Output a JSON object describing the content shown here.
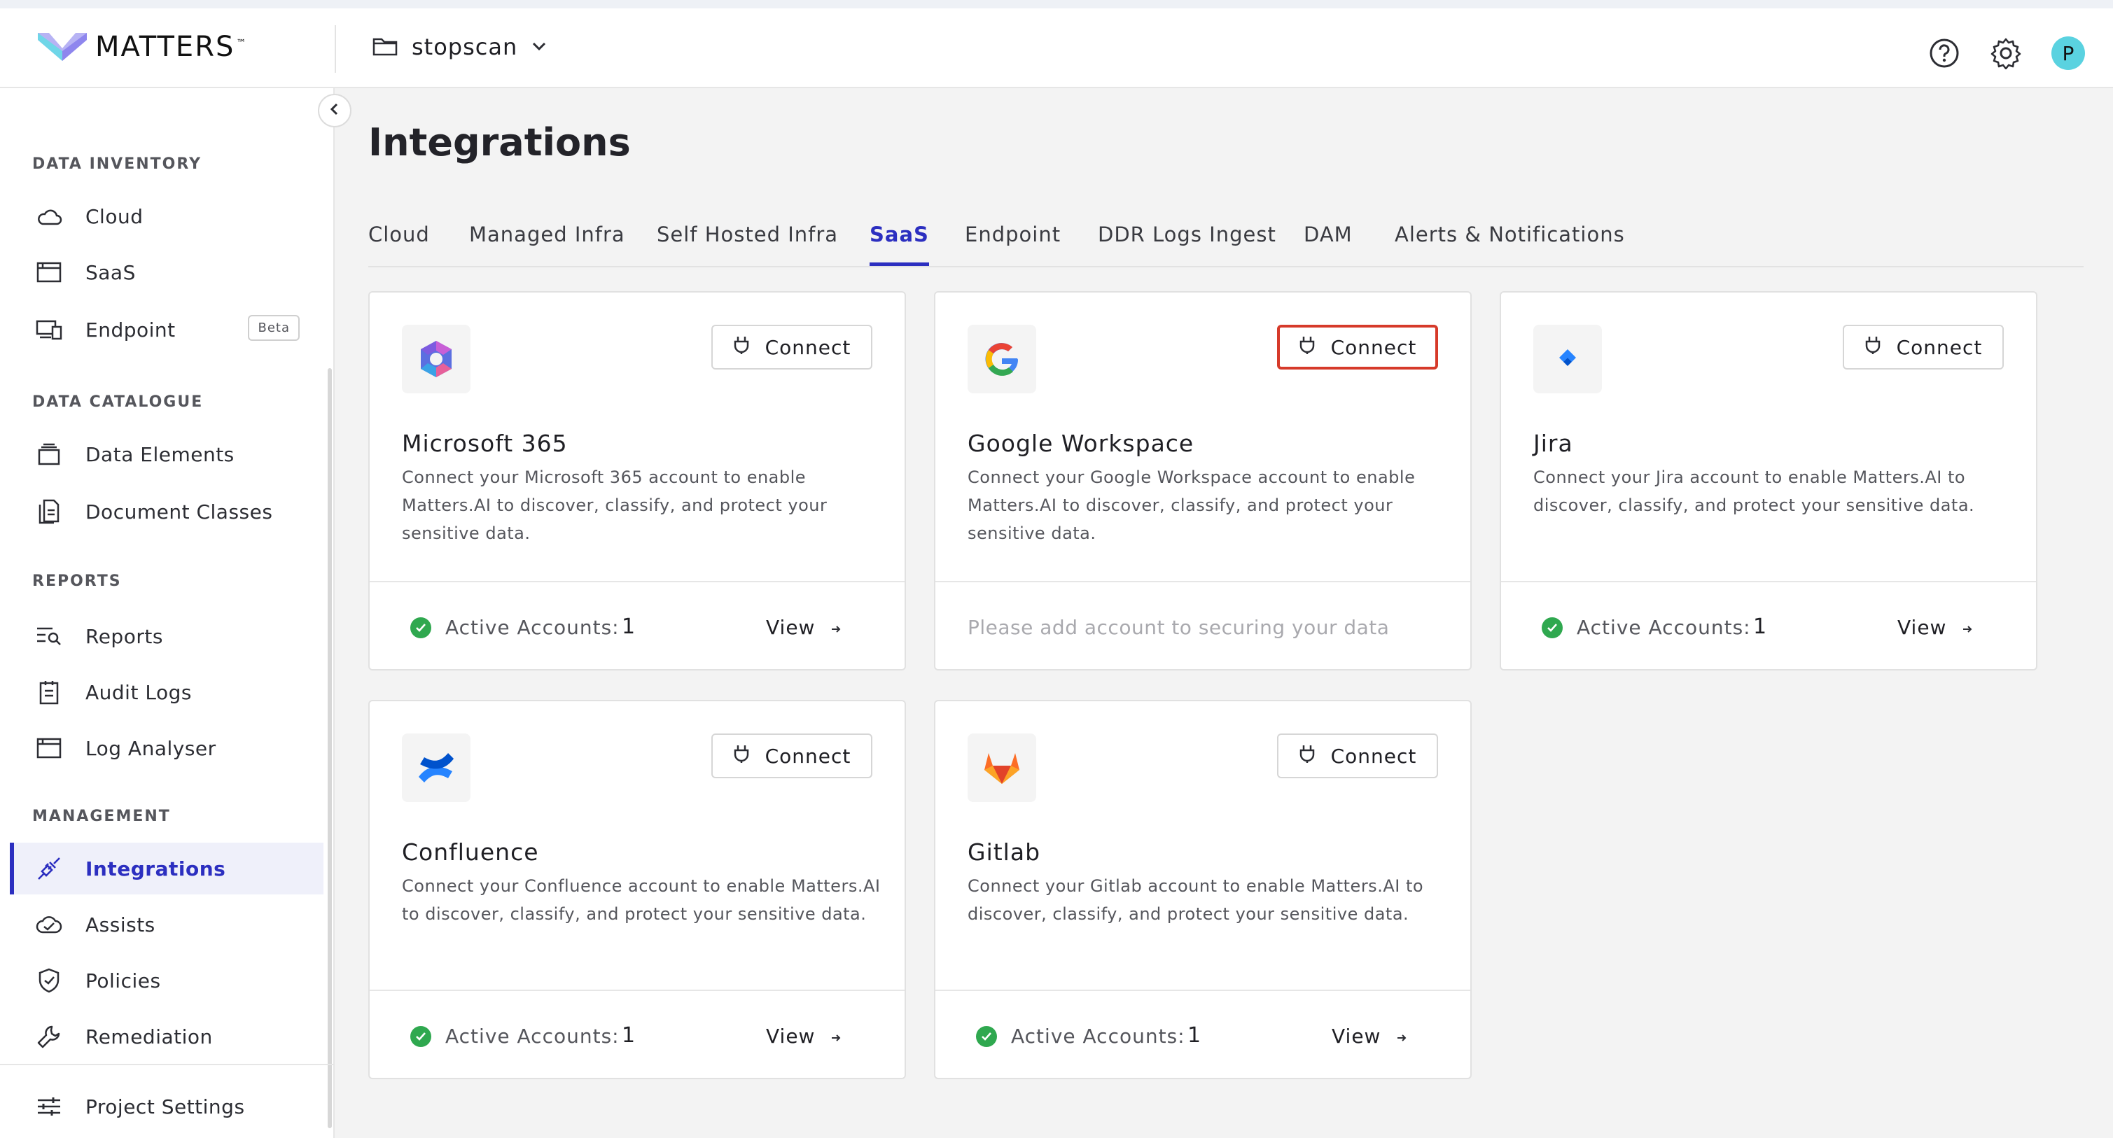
{
  "header": {
    "brand_name": "MATTERS",
    "brand_tm": "™",
    "project_name": "stopscan",
    "avatar_initial": "P"
  },
  "sidebar": {
    "sections": [
      {
        "title": "DATA INVENTORY",
        "items": [
          {
            "label": "Cloud",
            "icon": "cloud-icon"
          },
          {
            "label": "SaaS",
            "icon": "window-icon"
          },
          {
            "label": "Endpoint",
            "icon": "devices-icon",
            "badge": "Beta"
          }
        ]
      },
      {
        "title": "DATA CATALOGUE",
        "items": [
          {
            "label": "Data Elements",
            "icon": "stack-icon"
          },
          {
            "label": "Document Classes",
            "icon": "document-icon"
          }
        ]
      },
      {
        "title": "REPORTS",
        "items": [
          {
            "label": "Reports",
            "icon": "report-search-icon"
          },
          {
            "label": "Audit Logs",
            "icon": "clipboard-icon"
          },
          {
            "label": "Log Analyser",
            "icon": "window-icon"
          }
        ]
      },
      {
        "title": "MANAGEMENT",
        "items": [
          {
            "label": "Integrations",
            "icon": "plug-icon",
            "active": true
          },
          {
            "label": "Assists",
            "icon": "assist-icon"
          },
          {
            "label": "Policies",
            "icon": "shield-icon"
          },
          {
            "label": "Remediation",
            "icon": "wrench-icon"
          }
        ]
      }
    ],
    "footer_item": {
      "label": "Project Settings",
      "icon": "sliders-icon"
    }
  },
  "main": {
    "title": "Integrations",
    "tabs": [
      {
        "label": "Cloud"
      },
      {
        "label": "Managed Infra"
      },
      {
        "label": "Self Hosted Infra"
      },
      {
        "label": "SaaS",
        "active": true
      },
      {
        "label": "Endpoint"
      },
      {
        "label": "DDR Logs Ingest"
      },
      {
        "label": "DAM"
      },
      {
        "label": "Alerts & Notifications"
      }
    ],
    "connect_label": "Connect",
    "active_accounts_label": "Active Accounts:",
    "view_label": "View",
    "cards": [
      {
        "name": "Microsoft 365",
        "logo": "microsoft-365-logo",
        "description": "Connect your Microsoft 365 account to enable Matters.AI to discover, classify, and protect your sensitive data.",
        "active_accounts": "1"
      },
      {
        "name": "Google Workspace",
        "logo": "google-logo",
        "description": "Connect your Google Workspace account to enable Matters.AI to discover, classify, and protect your sensitive data.",
        "empty_note": "Please add account to securing your data",
        "highlighted": true
      },
      {
        "name": "Jira",
        "logo": "jira-logo",
        "description": "Connect your Jira account to enable Matters.AI to discover, classify, and protect your sensitive data.",
        "active_accounts": "1"
      },
      {
        "name": "Confluence",
        "logo": "confluence-logo",
        "description": "Connect your Confluence account to enable Matters.AI to discover, classify, and protect your sensitive data.",
        "active_accounts": "1"
      },
      {
        "name": "Gitlab",
        "logo": "gitlab-logo",
        "description": "Connect your Gitlab account to enable Matters.AI to discover, classify, and protect your sensitive data.",
        "active_accounts": "1"
      }
    ]
  },
  "colors": {
    "accent": "#2c2fc0",
    "success": "#2fa84f",
    "highlight_border": "#d63a2a"
  }
}
